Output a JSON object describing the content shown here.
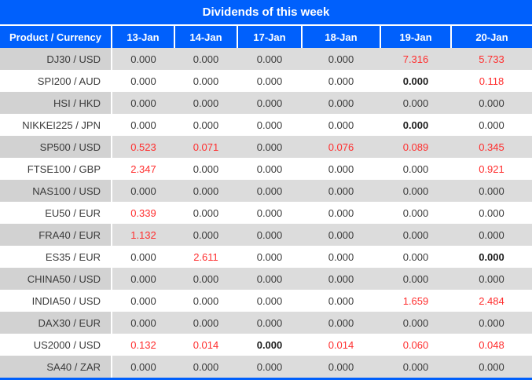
{
  "title": "Dividends of this week",
  "colors": {
    "header_bg": "#0060fc",
    "alt_row_label_bg": "#d2d2d2",
    "alt_row_data_bg": "#dcdcdc",
    "text": "#3a3a3a",
    "highlight_red": "#ff2e2e"
  },
  "table": {
    "columns": [
      "Product / Currency",
      "13-Jan",
      "14-Jan",
      "17-Jan",
      "18-Jan",
      "19-Jan",
      "20-Jan"
    ],
    "rows": [
      {
        "product": "DJ30 / USD",
        "values": [
          "0.000",
          "0.000",
          "0.000",
          "0.000",
          "7.316",
          "5.733"
        ],
        "red": [
          4,
          5
        ],
        "bold": []
      },
      {
        "product": "SPI200 / AUD",
        "values": [
          "0.000",
          "0.000",
          "0.000",
          "0.000",
          "0.000",
          "0.118"
        ],
        "red": [
          5
        ],
        "bold": [
          4
        ]
      },
      {
        "product": "HSI / HKD",
        "values": [
          "0.000",
          "0.000",
          "0.000",
          "0.000",
          "0.000",
          "0.000"
        ],
        "red": [],
        "bold": []
      },
      {
        "product": "NIKKEI225 / JPN",
        "values": [
          "0.000",
          "0.000",
          "0.000",
          "0.000",
          "0.000",
          "0.000"
        ],
        "red": [],
        "bold": [
          4
        ]
      },
      {
        "product": "SP500 / USD",
        "values": [
          "0.523",
          "0.071",
          "0.000",
          "0.076",
          "0.089",
          "0.345"
        ],
        "red": [
          0,
          1,
          3,
          4,
          5
        ],
        "bold": []
      },
      {
        "product": "FTSE100 / GBP",
        "values": [
          "2.347",
          "0.000",
          "0.000",
          "0.000",
          "0.000",
          "0.921"
        ],
        "red": [
          0,
          5
        ],
        "bold": []
      },
      {
        "product": "NAS100 / USD",
        "values": [
          "0.000",
          "0.000",
          "0.000",
          "0.000",
          "0.000",
          "0.000"
        ],
        "red": [],
        "bold": []
      },
      {
        "product": "EU50 / EUR",
        "values": [
          "0.339",
          "0.000",
          "0.000",
          "0.000",
          "0.000",
          "0.000"
        ],
        "red": [
          0
        ],
        "bold": []
      },
      {
        "product": "FRA40 / EUR",
        "values": [
          "1.132",
          "0.000",
          "0.000",
          "0.000",
          "0.000",
          "0.000"
        ],
        "red": [
          0
        ],
        "bold": []
      },
      {
        "product": "ES35 / EUR",
        "values": [
          "0.000",
          "2.611",
          "0.000",
          "0.000",
          "0.000",
          "0.000"
        ],
        "red": [
          1
        ],
        "bold": [
          5
        ]
      },
      {
        "product": "CHINA50 / USD",
        "values": [
          "0.000",
          "0.000",
          "0.000",
          "0.000",
          "0.000",
          "0.000"
        ],
        "red": [],
        "bold": []
      },
      {
        "product": "INDIA50 / USD",
        "values": [
          "0.000",
          "0.000",
          "0.000",
          "0.000",
          "1.659",
          "2.484"
        ],
        "red": [
          4,
          5
        ],
        "bold": []
      },
      {
        "product": "DAX30 / EUR",
        "values": [
          "0.000",
          "0.000",
          "0.000",
          "0.000",
          "0.000",
          "0.000"
        ],
        "red": [],
        "bold": []
      },
      {
        "product": "US2000 / USD",
        "values": [
          "0.132",
          "0.014",
          "0.000",
          "0.014",
          "0.060",
          "0.048"
        ],
        "red": [
          0,
          1,
          3,
          4,
          5
        ],
        "bold": [
          2
        ]
      },
      {
        "product": "SA40 / ZAR",
        "values": [
          "0.000",
          "0.000",
          "0.000",
          "0.000",
          "0.000",
          "0.000"
        ],
        "red": [],
        "bold": []
      }
    ]
  }
}
